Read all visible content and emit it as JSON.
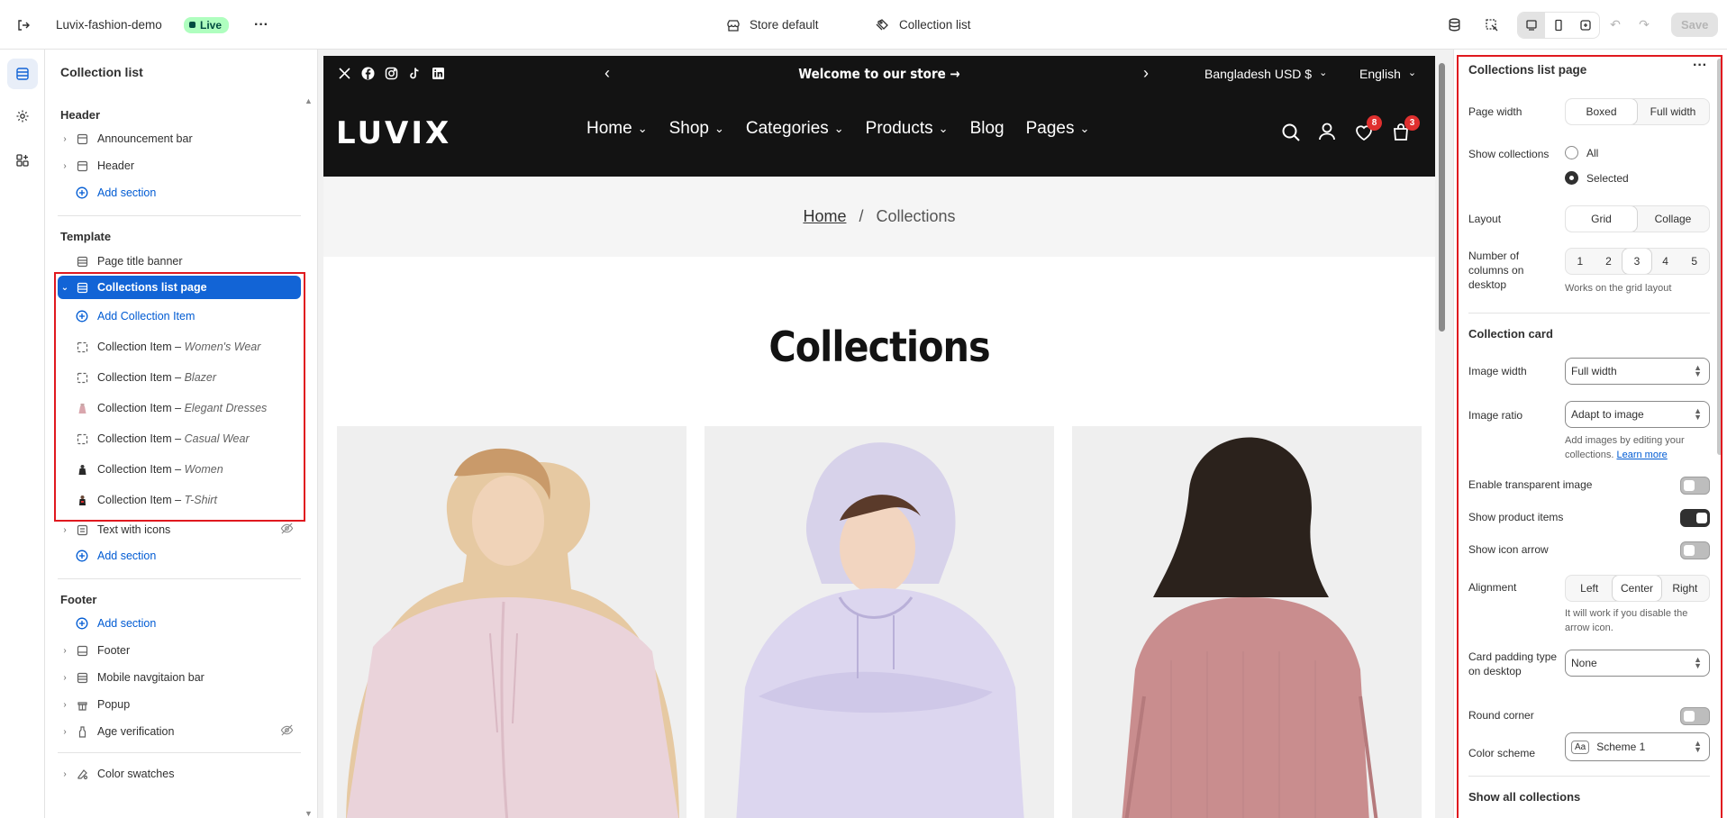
{
  "topbar": {
    "store_name": "Luvix-fashion-demo",
    "status": "Live",
    "more": "···",
    "store_context": "Store default",
    "page_context": "Collection list",
    "save_label": "Save"
  },
  "left_panel": {
    "title": "Collection list",
    "header_section": {
      "label": "Header",
      "items": [
        "Announcement bar",
        "Header"
      ],
      "add_label": "Add section"
    },
    "template_section": {
      "label": "Template",
      "page_title_banner": "Page title banner",
      "selected": "Collections list page",
      "add_collection_item": "Add Collection Item",
      "collection_items": [
        {
          "prefix": "Collection Item",
          "sep": " – ",
          "name": "Women's Wear"
        },
        {
          "prefix": "Collection Item",
          "sep": " – ",
          "name": "Blazer"
        },
        {
          "prefix": "Collection Item",
          "sep": " – ",
          "name": "Elegant Dresses"
        },
        {
          "prefix": "Collection Item",
          "sep": " – ",
          "name": "Casual Wear"
        },
        {
          "prefix": "Collection Item",
          "sep": " – ",
          "name": "Women"
        },
        {
          "prefix": "Collection Item",
          "sep": " – ",
          "name": "T-Shirt"
        }
      ],
      "text_with_icons": "Text with icons",
      "add_label": "Add section"
    },
    "footer_section": {
      "label": "Footer",
      "add_label": "Add section",
      "items": [
        "Footer",
        "Mobile navgitaion bar",
        "Popup",
        "Age verification"
      ]
    },
    "color_swatches": "Color swatches"
  },
  "preview": {
    "announcement": "Welcome to our store",
    "currency": "Bangladesh USD $",
    "language": "English",
    "logo": "LUVIX",
    "nav": [
      "Home",
      "Shop",
      "Categories",
      "Products",
      "Blog",
      "Pages"
    ],
    "wishlist_count": "8",
    "cart_count": "3",
    "breadcrumb_home": "Home",
    "breadcrumb_sep": "/",
    "breadcrumb_current": "Collections",
    "heading": "Collections"
  },
  "right_panel": {
    "title": "Collections list page",
    "page_width": {
      "label": "Page width",
      "options": [
        "Boxed",
        "Full width"
      ],
      "selected": "Boxed"
    },
    "show_collections": {
      "label": "Show collections",
      "options": [
        "All",
        "Selected"
      ],
      "selected": "Selected"
    },
    "layout": {
      "label": "Layout",
      "options": [
        "Grid",
        "Collage"
      ],
      "selected": "Grid"
    },
    "columns": {
      "label": "Number of columns on desktop",
      "options": [
        "1",
        "2",
        "3",
        "4",
        "5"
      ],
      "selected": "3",
      "help": "Works on the grid layout"
    },
    "collection_card_heading": "Collection card",
    "image_width": {
      "label": "Image width",
      "value": "Full width"
    },
    "image_ratio": {
      "label": "Image ratio",
      "value": "Adapt to image",
      "help": "Add images by editing your collections.",
      "help_link": "Learn more"
    },
    "transparent_image": {
      "label": "Enable transparent image",
      "on": false
    },
    "show_product_items": {
      "label": "Show product items",
      "on": true
    },
    "show_icon_arrow": {
      "label": "Show icon arrow",
      "on": false
    },
    "alignment": {
      "label": "Alignment",
      "options": [
        "Left",
        "Center",
        "Right"
      ],
      "selected": "Center",
      "help": "It will work if you disable the arrow icon."
    },
    "card_padding": {
      "label": "Card padding type on desktop",
      "value": "None"
    },
    "round_corner": {
      "label": "Round corner",
      "on": false
    },
    "color_scheme": {
      "label": "Color scheme",
      "value": "Scheme 1",
      "swatch": "Aa"
    },
    "show_all_heading": "Show all collections"
  },
  "colors": {
    "selected_blue": "#1264d6",
    "link_blue": "#005bd3",
    "highlight_red": "#e0191f",
    "live_green": "#affebf",
    "store_black": "#131313",
    "badge_red": "#e0302f"
  }
}
